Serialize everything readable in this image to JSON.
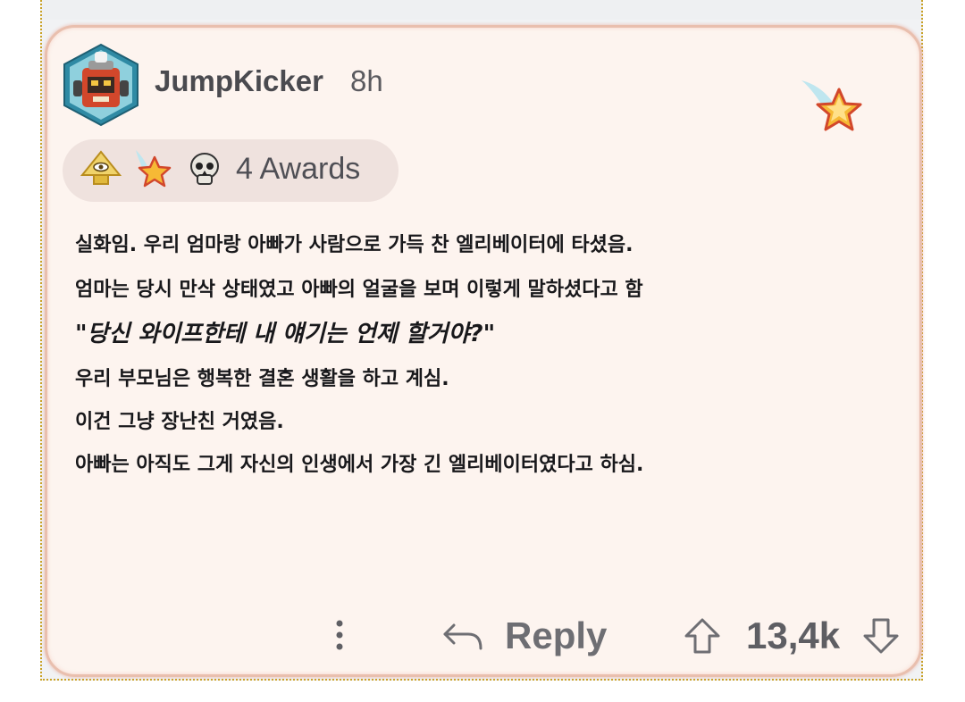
{
  "comment": {
    "username": "JumpKicker",
    "time_ago": "8h",
    "awards_label": "4 Awards",
    "awards": [
      {
        "icon": "pyramid-eye-icon"
      },
      {
        "icon": "shooting-star-icon"
      },
      {
        "icon": "skull-icon"
      }
    ],
    "body_lines": [
      "실화임. 우리 엄마랑 아빠가 사람으로 가득 찬 엘리베이터에 타셨음.",
      "엄마는 당시 만삭 상태였고 아빠의 얼굴을 보며 이렇게 말하셨다고 함",
      "\"당신 와이프한테 내 얘기는 언제 할거야?\"",
      "우리 부모님은 행복한 결혼 생활을 하고 계심.",
      "이건 그냥 장난친 거였음.",
      "아빠는 아직도 그게 자신의 인생에서 가장 긴 엘리베이터였다고 하심."
    ]
  },
  "footer": {
    "reply_label": "Reply",
    "score": "13,4k"
  },
  "colors": {
    "card_background": "#fdf4ef",
    "card_border": "#e9bfae",
    "awards_pill": "#efe2de",
    "text_primary": "#18181b",
    "text_secondary": "#6e6e73"
  }
}
